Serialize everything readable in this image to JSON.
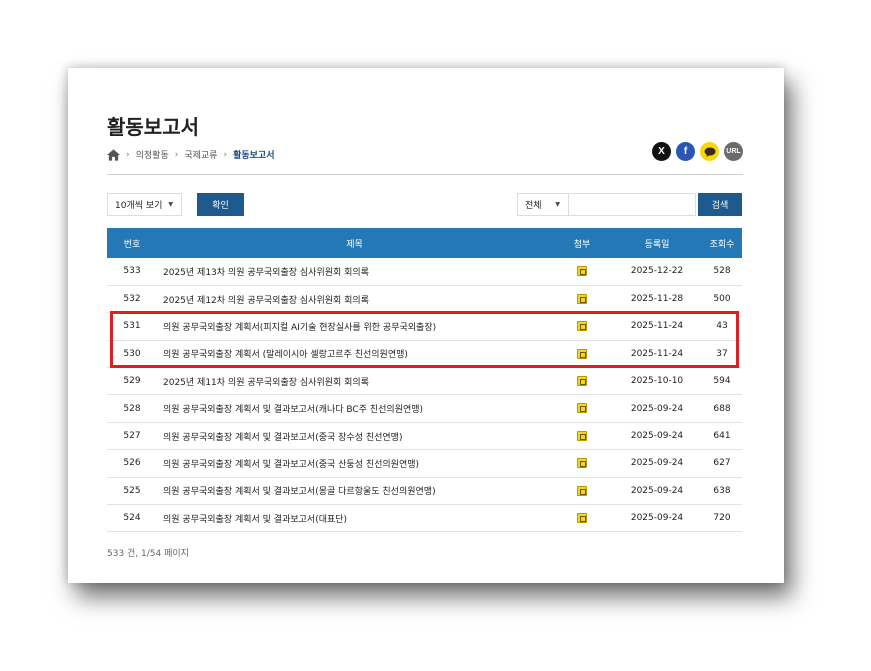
{
  "header": {
    "title": "활동보고서",
    "breadcrumb": [
      "의정활동",
      "국제교류",
      "활동보고서"
    ]
  },
  "share": {
    "x_label": "X",
    "facebook_label": "f",
    "url_label": "URL"
  },
  "controls": {
    "page_size": "10개씩 보기",
    "confirm_label": "확인",
    "search_scope": "전체",
    "search_value": "",
    "search_label": "검색"
  },
  "table": {
    "headers": {
      "no": "번호",
      "title": "제목",
      "attachment": "첨부",
      "date": "등록일",
      "views": "조회수"
    },
    "rows": [
      {
        "no": "533",
        "title": "2025년 제13차 의원 공무국외출장 심사위원회 회의록",
        "date": "2025-12-22",
        "views": "528"
      },
      {
        "no": "532",
        "title": "2025년 제12차 의원 공무국외출장 심사위원회 회의록",
        "date": "2025-11-28",
        "views": "500"
      },
      {
        "no": "531",
        "title": "의원 공무국외출장 계획서(피지컬 AI기술 현장실사를 위한 공무국외출장)",
        "date": "2025-11-24",
        "views": "43"
      },
      {
        "no": "530",
        "title": "의원 공무국외출장 계획서 (말레이시아 셀랑고르주 친선의원연맹)",
        "date": "2025-11-24",
        "views": "37"
      },
      {
        "no": "529",
        "title": "2025년 제11차 의원 공무국외출장 심사위원회 회의록",
        "date": "2025-10-10",
        "views": "594"
      },
      {
        "no": "528",
        "title": "의원 공무국외출장 계획서 및 결과보고서(캐나다 BC주 친선의원연맹)",
        "date": "2025-09-24",
        "views": "688"
      },
      {
        "no": "527",
        "title": "의원 공무국외출장 계획서 및 결과보고서(중국 장수성 친선연맹)",
        "date": "2025-09-24",
        "views": "641"
      },
      {
        "no": "526",
        "title": "의원 공무국외출장 계획서 및 결과보고서(중국 산둥성 친선의원연맹)",
        "date": "2025-09-24",
        "views": "627"
      },
      {
        "no": "525",
        "title": "의원 공무국외출장 계획서 및 결과보고서(몽골 다르항울도 친선의원연맹)",
        "date": "2025-09-24",
        "views": "638"
      },
      {
        "no": "524",
        "title": "의원 공무국외출장 계획서 및 결과보고서(대표단)",
        "date": "2025-09-24",
        "views": "720"
      }
    ]
  },
  "footer": {
    "page_info": "533 건, 1/54 페이지"
  },
  "colors": {
    "accent": "#2378b5",
    "button": "#1f5a8f",
    "highlight": "#e02020"
  }
}
